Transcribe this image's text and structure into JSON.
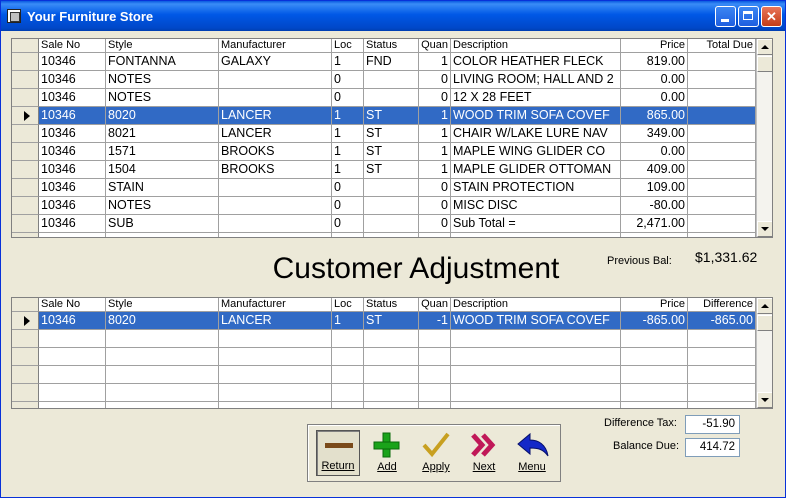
{
  "window": {
    "title": "Your Furniture Store",
    "minimize_glyph": "",
    "maximize_glyph": "",
    "close_glyph": "✕"
  },
  "columns": [
    "Sale No",
    "Style",
    "Manufacturer",
    "Loc",
    "Status",
    "Quan",
    "Description",
    "Price",
    "Total Due"
  ],
  "columns_bottom": [
    "Sale No",
    "Style",
    "Manufacturer",
    "Loc",
    "Status",
    "Quan",
    "Description",
    "Price",
    "Difference"
  ],
  "sales_rows": [
    [
      "10346",
      "FONTANNA",
      "GALAXY",
      "1",
      "FND",
      "1",
      "COLOR  HEATHER FLECK",
      "819.00",
      ""
    ],
    [
      "10346",
      "NOTES",
      "",
      "0",
      "",
      "0",
      "LIVING ROOM; HALL AND 2",
      "0.00",
      ""
    ],
    [
      "10346",
      "NOTES",
      "",
      "0",
      "",
      "0",
      "12 X 28 FEET",
      "0.00",
      ""
    ],
    [
      "10346",
      "8020",
      "LANCER",
      "1",
      "ST",
      "1",
      "WOOD TRIM SOFA COVEF",
      "865.00",
      ""
    ],
    [
      "10346",
      "8021",
      "LANCER",
      "1",
      "ST",
      "1",
      "CHAIR W/LAKE LURE NAV",
      "349.00",
      ""
    ],
    [
      "10346",
      "1571",
      "BROOKS",
      "1",
      "ST",
      "1",
      "MAPLE WING GLIDER  CO",
      "0.00",
      ""
    ],
    [
      "10346",
      "1504",
      "BROOKS",
      "1",
      "ST",
      "1",
      "MAPLE GLIDER OTTOMAN",
      "409.00",
      ""
    ],
    [
      "10346",
      "STAIN",
      "",
      "0",
      "",
      "0",
      "STAIN PROTECTION",
      "109.00",
      ""
    ],
    [
      "10346",
      "NOTES",
      "",
      "0",
      "",
      "0",
      "MISC DISC",
      "-80.00",
      ""
    ],
    [
      "10346",
      "SUB",
      "",
      "0",
      "",
      "0",
      "Sub Total =",
      "2,471.00",
      ""
    ]
  ],
  "adjustment_rows": [
    [
      "10346",
      "8020",
      "LANCER",
      "1",
      "ST",
      "-1",
      "WOOD TRIM SOFA COVEF",
      "-865.00",
      "-865.00"
    ]
  ],
  "heading": "Customer Adjustment",
  "previous_balance": {
    "label": "Previous Bal:",
    "value": "$1,331.62"
  },
  "difference_tax": {
    "label": "Difference Tax:",
    "value": "-51.90"
  },
  "balance_due": {
    "label": "Balance Due:",
    "value": "414.72"
  },
  "buttons": {
    "return": "Return",
    "add": "Add",
    "apply": "Apply",
    "next": "Next",
    "menu": "Menu"
  },
  "colors": {
    "selection": "#316ac5",
    "add_icon": "#1aa31a",
    "next_icon": "#c01858",
    "menu_icon": "#1428c8"
  }
}
